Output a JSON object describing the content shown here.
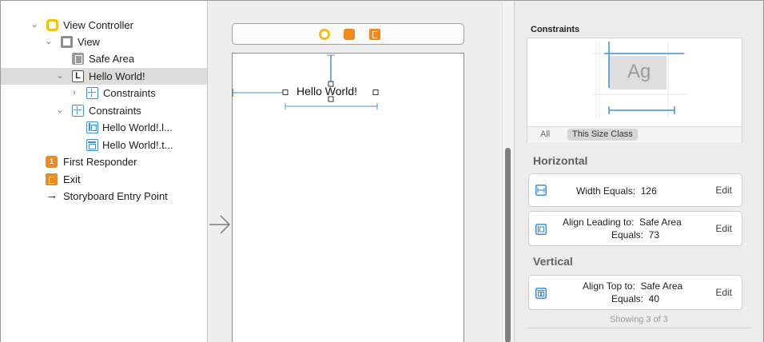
{
  "outline": {
    "items": [
      {
        "label": "View Controller",
        "icon": "view-controller-icon"
      },
      {
        "label": "View",
        "icon": "view-icon"
      },
      {
        "label": "Safe Area",
        "icon": "safe-area-icon"
      },
      {
        "label": "Hello World!",
        "icon": "label-icon",
        "selected": true
      },
      {
        "label": "Constraints",
        "icon": "constraints-icon"
      },
      {
        "label": "Constraints",
        "icon": "constraints-icon"
      },
      {
        "label": "Hello World!.l...",
        "icon": "leading-constraint-icon"
      },
      {
        "label": "Hello World!.t...",
        "icon": "top-constraint-icon"
      },
      {
        "label": "First Responder",
        "icon": "first-responder-icon"
      },
      {
        "label": "Exit",
        "icon": "exit-icon"
      },
      {
        "label": "Storyboard Entry Point",
        "icon": "arrow-right-icon"
      }
    ]
  },
  "canvas": {
    "label_text": "Hello World!",
    "dock_icons": [
      "view-controller-icon",
      "first-responder-icon",
      "exit-icon"
    ],
    "entry_arrow": "arrow-right-icon"
  },
  "inspector": {
    "title": "Constraints",
    "preview_text": "Ag",
    "segments": [
      "All",
      "This Size Class"
    ],
    "horizontal_title": "Horizontal",
    "vertical_title": "Vertical",
    "horizontal": [
      {
        "k1": "Width Equals:",
        "v1": "126",
        "edit": "Edit",
        "icon": "width-constraint-icon"
      },
      {
        "k1": "Align Leading to:",
        "v1": "Safe Area",
        "k2": "Equals:",
        "v2": "73",
        "edit": "Edit",
        "icon": "leading-constraint-icon"
      }
    ],
    "vertical": [
      {
        "k1": "Align Top to:",
        "v1": "Safe Area",
        "k2": "Equals:",
        "v2": "40",
        "edit": "Edit",
        "icon": "top-constraint-icon"
      }
    ],
    "showing": "Showing 3 of 3"
  },
  "colors": {
    "accent_blue": "#3d8fe0",
    "orange": "#f08a1d",
    "yellow": "#f5bd16",
    "selection": "#dcdcdc"
  }
}
